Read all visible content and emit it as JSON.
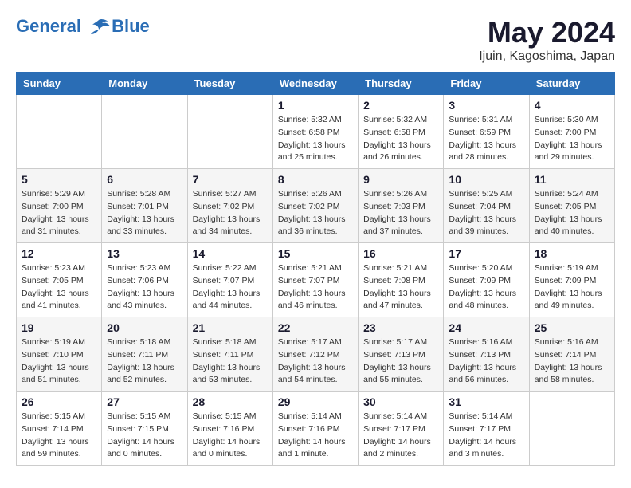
{
  "header": {
    "logo_line1": "General",
    "logo_line2": "Blue",
    "month_title": "May 2024",
    "location": "Ijuin, Kagoshima, Japan"
  },
  "weekdays": [
    "Sunday",
    "Monday",
    "Tuesday",
    "Wednesday",
    "Thursday",
    "Friday",
    "Saturday"
  ],
  "weeks": [
    [
      {
        "day": "",
        "sunrise": "",
        "sunset": "",
        "daylight": ""
      },
      {
        "day": "",
        "sunrise": "",
        "sunset": "",
        "daylight": ""
      },
      {
        "day": "",
        "sunrise": "",
        "sunset": "",
        "daylight": ""
      },
      {
        "day": "1",
        "sunrise": "Sunrise: 5:32 AM",
        "sunset": "Sunset: 6:58 PM",
        "daylight": "Daylight: 13 hours and 25 minutes."
      },
      {
        "day": "2",
        "sunrise": "Sunrise: 5:32 AM",
        "sunset": "Sunset: 6:58 PM",
        "daylight": "Daylight: 13 hours and 26 minutes."
      },
      {
        "day": "3",
        "sunrise": "Sunrise: 5:31 AM",
        "sunset": "Sunset: 6:59 PM",
        "daylight": "Daylight: 13 hours and 28 minutes."
      },
      {
        "day": "4",
        "sunrise": "Sunrise: 5:30 AM",
        "sunset": "Sunset: 7:00 PM",
        "daylight": "Daylight: 13 hours and 29 minutes."
      }
    ],
    [
      {
        "day": "5",
        "sunrise": "Sunrise: 5:29 AM",
        "sunset": "Sunset: 7:00 PM",
        "daylight": "Daylight: 13 hours and 31 minutes."
      },
      {
        "day": "6",
        "sunrise": "Sunrise: 5:28 AM",
        "sunset": "Sunset: 7:01 PM",
        "daylight": "Daylight: 13 hours and 33 minutes."
      },
      {
        "day": "7",
        "sunrise": "Sunrise: 5:27 AM",
        "sunset": "Sunset: 7:02 PM",
        "daylight": "Daylight: 13 hours and 34 minutes."
      },
      {
        "day": "8",
        "sunrise": "Sunrise: 5:26 AM",
        "sunset": "Sunset: 7:02 PM",
        "daylight": "Daylight: 13 hours and 36 minutes."
      },
      {
        "day": "9",
        "sunrise": "Sunrise: 5:26 AM",
        "sunset": "Sunset: 7:03 PM",
        "daylight": "Daylight: 13 hours and 37 minutes."
      },
      {
        "day": "10",
        "sunrise": "Sunrise: 5:25 AM",
        "sunset": "Sunset: 7:04 PM",
        "daylight": "Daylight: 13 hours and 39 minutes."
      },
      {
        "day": "11",
        "sunrise": "Sunrise: 5:24 AM",
        "sunset": "Sunset: 7:05 PM",
        "daylight": "Daylight: 13 hours and 40 minutes."
      }
    ],
    [
      {
        "day": "12",
        "sunrise": "Sunrise: 5:23 AM",
        "sunset": "Sunset: 7:05 PM",
        "daylight": "Daylight: 13 hours and 41 minutes."
      },
      {
        "day": "13",
        "sunrise": "Sunrise: 5:23 AM",
        "sunset": "Sunset: 7:06 PM",
        "daylight": "Daylight: 13 hours and 43 minutes."
      },
      {
        "day": "14",
        "sunrise": "Sunrise: 5:22 AM",
        "sunset": "Sunset: 7:07 PM",
        "daylight": "Daylight: 13 hours and 44 minutes."
      },
      {
        "day": "15",
        "sunrise": "Sunrise: 5:21 AM",
        "sunset": "Sunset: 7:07 PM",
        "daylight": "Daylight: 13 hours and 46 minutes."
      },
      {
        "day": "16",
        "sunrise": "Sunrise: 5:21 AM",
        "sunset": "Sunset: 7:08 PM",
        "daylight": "Daylight: 13 hours and 47 minutes."
      },
      {
        "day": "17",
        "sunrise": "Sunrise: 5:20 AM",
        "sunset": "Sunset: 7:09 PM",
        "daylight": "Daylight: 13 hours and 48 minutes."
      },
      {
        "day": "18",
        "sunrise": "Sunrise: 5:19 AM",
        "sunset": "Sunset: 7:09 PM",
        "daylight": "Daylight: 13 hours and 49 minutes."
      }
    ],
    [
      {
        "day": "19",
        "sunrise": "Sunrise: 5:19 AM",
        "sunset": "Sunset: 7:10 PM",
        "daylight": "Daylight: 13 hours and 51 minutes."
      },
      {
        "day": "20",
        "sunrise": "Sunrise: 5:18 AM",
        "sunset": "Sunset: 7:11 PM",
        "daylight": "Daylight: 13 hours and 52 minutes."
      },
      {
        "day": "21",
        "sunrise": "Sunrise: 5:18 AM",
        "sunset": "Sunset: 7:11 PM",
        "daylight": "Daylight: 13 hours and 53 minutes."
      },
      {
        "day": "22",
        "sunrise": "Sunrise: 5:17 AM",
        "sunset": "Sunset: 7:12 PM",
        "daylight": "Daylight: 13 hours and 54 minutes."
      },
      {
        "day": "23",
        "sunrise": "Sunrise: 5:17 AM",
        "sunset": "Sunset: 7:13 PM",
        "daylight": "Daylight: 13 hours and 55 minutes."
      },
      {
        "day": "24",
        "sunrise": "Sunrise: 5:16 AM",
        "sunset": "Sunset: 7:13 PM",
        "daylight": "Daylight: 13 hours and 56 minutes."
      },
      {
        "day": "25",
        "sunrise": "Sunrise: 5:16 AM",
        "sunset": "Sunset: 7:14 PM",
        "daylight": "Daylight: 13 hours and 58 minutes."
      }
    ],
    [
      {
        "day": "26",
        "sunrise": "Sunrise: 5:15 AM",
        "sunset": "Sunset: 7:14 PM",
        "daylight": "Daylight: 13 hours and 59 minutes."
      },
      {
        "day": "27",
        "sunrise": "Sunrise: 5:15 AM",
        "sunset": "Sunset: 7:15 PM",
        "daylight": "Daylight: 14 hours and 0 minutes."
      },
      {
        "day": "28",
        "sunrise": "Sunrise: 5:15 AM",
        "sunset": "Sunset: 7:16 PM",
        "daylight": "Daylight: 14 hours and 0 minutes."
      },
      {
        "day": "29",
        "sunrise": "Sunrise: 5:14 AM",
        "sunset": "Sunset: 7:16 PM",
        "daylight": "Daylight: 14 hours and 1 minute."
      },
      {
        "day": "30",
        "sunrise": "Sunrise: 5:14 AM",
        "sunset": "Sunset: 7:17 PM",
        "daylight": "Daylight: 14 hours and 2 minutes."
      },
      {
        "day": "31",
        "sunrise": "Sunrise: 5:14 AM",
        "sunset": "Sunset: 7:17 PM",
        "daylight": "Daylight: 14 hours and 3 minutes."
      },
      {
        "day": "",
        "sunrise": "",
        "sunset": "",
        "daylight": ""
      }
    ]
  ]
}
